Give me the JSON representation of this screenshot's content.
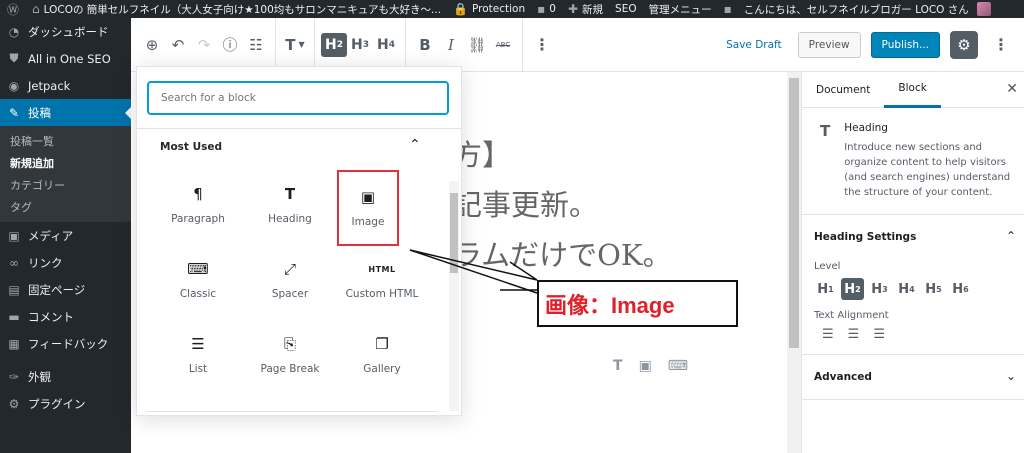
{
  "adminbar": {
    "site_title": "LOCOの 簡単セルフネイル（大人女子向け★100均もサロンマニキュアも大好き〜...",
    "protection": "Protection",
    "comments_count": "0",
    "new": "新規",
    "seo": "SEO",
    "admin_menu": "管理メニュー",
    "greeting": "こんにちは、セルフネイルブロガー LOCO さん"
  },
  "sidebar": {
    "items": [
      {
        "label": "ダッシュボード",
        "icon": "dashboard-icon"
      },
      {
        "label": "All in One SEO",
        "icon": "shield-icon"
      },
      {
        "label": "Jetpack",
        "icon": "jetpack-icon"
      },
      {
        "label": "投稿",
        "icon": "pin-icon"
      },
      {
        "label": "メディア",
        "icon": "media-icon"
      },
      {
        "label": "リンク",
        "icon": "link-icon"
      },
      {
        "label": "固定ページ",
        "icon": "page-icon"
      },
      {
        "label": "コメント",
        "icon": "comment-icon"
      },
      {
        "label": "フィードバック",
        "icon": "feedback-icon"
      },
      {
        "label": "外観",
        "icon": "brush-icon"
      },
      {
        "label": "プラグイン",
        "icon": "plugin-icon"
      }
    ],
    "submenu": [
      "投稿一覧",
      "新規追加",
      "カテゴリー",
      "タグ"
    ]
  },
  "toolbar": {
    "save_draft": "Save Draft",
    "preview": "Preview",
    "publish": "Publish...",
    "transform_label": "T",
    "h2": "H",
    "h3": "H",
    "h4": "H",
    "sub2": "2",
    "sub3": "3",
    "sub4": "4",
    "bold": "B",
    "italic": "I",
    "strike": "ABC"
  },
  "canvas": {
    "lines": [
      "方】",
      "記事更新。",
      "ラムだけでOK。"
    ]
  },
  "inserter": {
    "search_placeholder": "Search for a block",
    "section_title": "Most Used",
    "blocks": [
      {
        "label": "Paragraph",
        "icon": "¶"
      },
      {
        "label": "Heading",
        "icon": "T"
      },
      {
        "label": "Image",
        "icon": "▣"
      },
      {
        "label": "Classic",
        "icon": "⌨"
      },
      {
        "label": "Spacer",
        "icon": "⤢"
      },
      {
        "label": "Custom HTML",
        "icon": "HTML"
      },
      {
        "label": "List",
        "icon": "☰"
      },
      {
        "label": "Page Break",
        "icon": "⎘"
      },
      {
        "label": "Gallery",
        "icon": "❐"
      }
    ]
  },
  "callout": {
    "text": "画像：Image"
  },
  "panel": {
    "tab_document": "Document",
    "tab_block": "Block",
    "block_icon": "T",
    "block_title": "Heading",
    "block_desc": "Introduce new sections and organize content to help visitors (and search engines) understand the structure of your content.",
    "heading_settings": "Heading Settings",
    "level_label": "Level",
    "levels": [
      "1",
      "2",
      "3",
      "4",
      "5",
      "6"
    ],
    "level_letter": "H",
    "text_alignment": "Text Alignment",
    "advanced": "Advanced"
  },
  "colors": {
    "admin_bg": "#23282d",
    "accent": "#0073aa",
    "publish": "#0085ba",
    "highlight": "#e0323c"
  }
}
